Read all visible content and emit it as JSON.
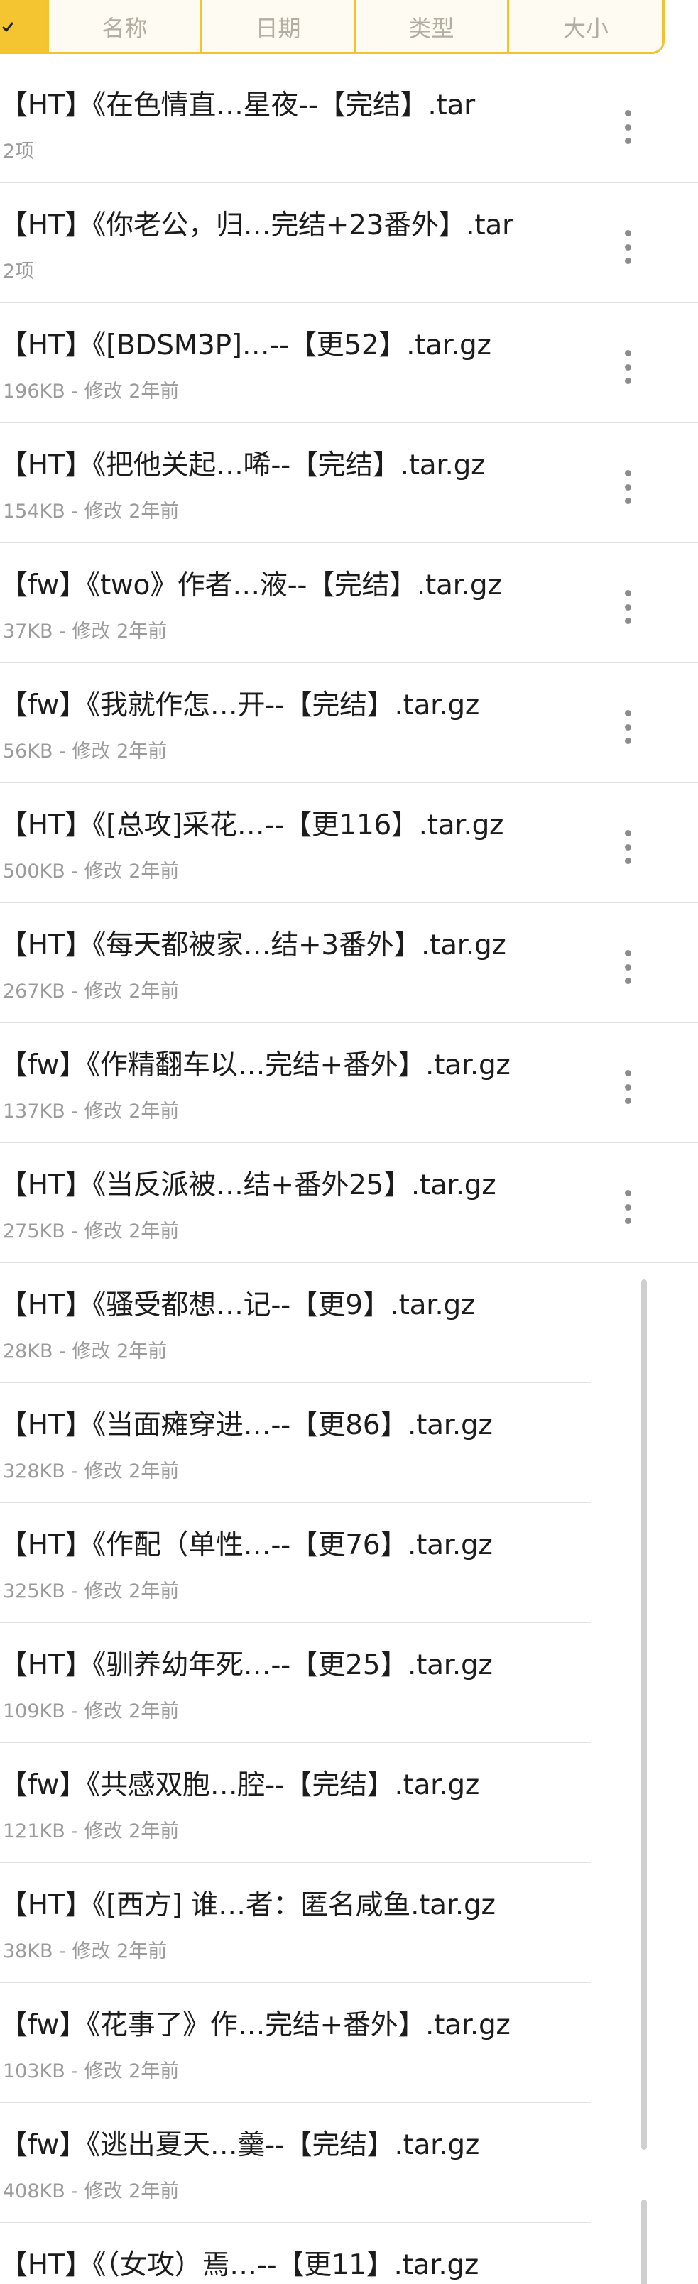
{
  "sort_bar": {
    "tabs": [
      {
        "label": "名称"
      },
      {
        "label": "日期"
      },
      {
        "label": "类型"
      },
      {
        "label": "大小"
      }
    ],
    "accent_color": "#f4c531"
  },
  "files": [
    {
      "title": "【HT】《在色情直…星夜--【完结】.tar",
      "meta": "2项"
    },
    {
      "title": "【HT】《你老公，归…完结+23番外】.tar",
      "meta": "2项"
    },
    {
      "title": "【HT】《[BDSM3P]…--【更52】.tar.gz",
      "meta": "196KB - 修改 2年前"
    },
    {
      "title": "【HT】《把他关起…唏--【完结】.tar.gz",
      "meta": "154KB - 修改 2年前"
    },
    {
      "title": "【fw】《two》作者…液--【完结】.tar.gz",
      "meta": "37KB - 修改 2年前"
    },
    {
      "title": "【fw】《我就作怎…开--【完结】.tar.gz",
      "meta": "56KB - 修改 2年前"
    },
    {
      "title": "【HT】《[总攻]采花…--【更116】.tar.gz",
      "meta": "500KB - 修改 2年前"
    },
    {
      "title": "【HT】《每天都被家…结+3番外】.tar.gz",
      "meta": "267KB - 修改 2年前"
    },
    {
      "title": "【fw】《作精翻车以…完结+番外】.tar.gz",
      "meta": "137KB - 修改 2年前"
    },
    {
      "title": "【HT】《当反派被…结+番外25】.tar.gz",
      "meta": "275KB - 修改 2年前"
    },
    {
      "title": "【HT】《骚受都想…记--【更9】.tar.gz",
      "meta": "28KB - 修改 2年前"
    },
    {
      "title": "【HT】《当面瘫穿进…--【更86】.tar.gz",
      "meta": "328KB - 修改 2年前"
    },
    {
      "title": "【HT】《作配（单性…--【更76】.tar.gz",
      "meta": "325KB - 修改 2年前"
    },
    {
      "title": "【HT】《驯养幼年死…--【更25】.tar.gz",
      "meta": "109KB - 修改 2年前"
    },
    {
      "title": "【fw】《共感双胞…腔--【完结】.tar.gz",
      "meta": "121KB - 修改 2年前"
    },
    {
      "title": "【HT】《[西方] 谁…者：匿名咸鱼.tar.gz",
      "meta": "38KB - 修改 2年前"
    },
    {
      "title": "【fw】《花事了》作…完结+番外】.tar.gz",
      "meta": "103KB - 修改 2年前"
    },
    {
      "title": "【fw】《逃出夏天…羹--【完结】.tar.gz",
      "meta": "408KB - 修改 2年前"
    },
    {
      "title": "【HT】《（女攻）焉…--【更11】.tar.gz",
      "meta": ""
    }
  ]
}
